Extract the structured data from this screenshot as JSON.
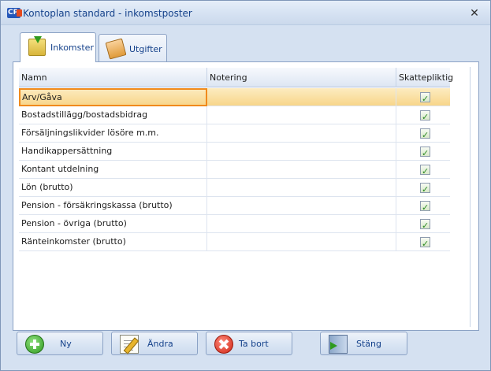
{
  "window": {
    "app_badge": "CP",
    "title": "Kontoplan standard - inkomstposter",
    "close_glyph": "✕"
  },
  "tabs": [
    {
      "label": "Inkomster",
      "icon": "income-folder-icon",
      "active": true
    },
    {
      "label": "Utgifter",
      "icon": "expense-folder-icon",
      "active": false
    }
  ],
  "grid": {
    "columns": [
      "Namn",
      "Notering",
      "Skattepliktig"
    ],
    "rows": [
      {
        "name": "Arv/Gåva",
        "note": "",
        "taxable": true,
        "selected": true
      },
      {
        "name": "Bostadstillägg/bostadsbidrag",
        "note": "",
        "taxable": true
      },
      {
        "name": "Försäljningslikvider lösöre m.m.",
        "note": "",
        "taxable": true
      },
      {
        "name": "Handikappersättning",
        "note": "",
        "taxable": true
      },
      {
        "name": "Kontant utdelning",
        "note": "",
        "taxable": true
      },
      {
        "name": "Lön (brutto)",
        "note": "",
        "taxable": true
      },
      {
        "name": "Pension - försäkringskassa (brutto)",
        "note": "",
        "taxable": true
      },
      {
        "name": "Pension - övriga (brutto)",
        "note": "",
        "taxable": true
      },
      {
        "name": "Ränteinkomster (brutto)",
        "note": "",
        "taxable": true
      }
    ]
  },
  "buttons": {
    "new": "Ny",
    "edit": "Ändra",
    "delete": "Ta bort",
    "close": "Stäng"
  },
  "colors": {
    "accent": "#15428b",
    "selection": "#f8d68a",
    "selection_border": "#f08a1c"
  }
}
